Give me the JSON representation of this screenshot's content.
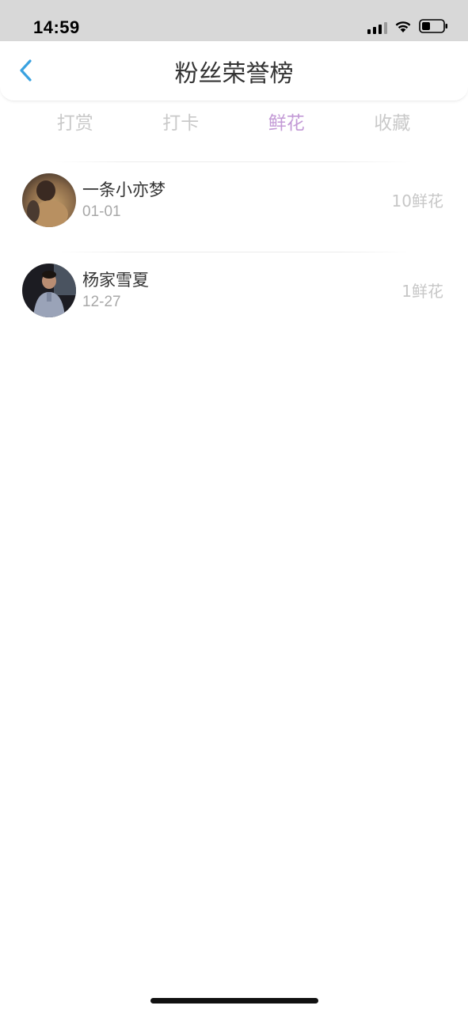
{
  "status_bar": {
    "time": "14:59"
  },
  "header": {
    "title": "粉丝荣誉榜"
  },
  "tabs": [
    {
      "label": "打赏",
      "active": false
    },
    {
      "label": "打卡",
      "active": false
    },
    {
      "label": "鲜花",
      "active": true
    },
    {
      "label": "收藏",
      "active": false
    }
  ],
  "colors": {
    "active_tab": "#c39ad6",
    "inactive_tab": "#c9c9c9",
    "back_arrow": "#3aa2e0",
    "status_bar_bg": "#d8d8d8"
  },
  "fans": [
    {
      "name": "一条小亦梦",
      "date": "01-01",
      "count": "10鲜花"
    },
    {
      "name": "杨家雪夏",
      "date": "12-27",
      "count": "1鲜花"
    }
  ]
}
